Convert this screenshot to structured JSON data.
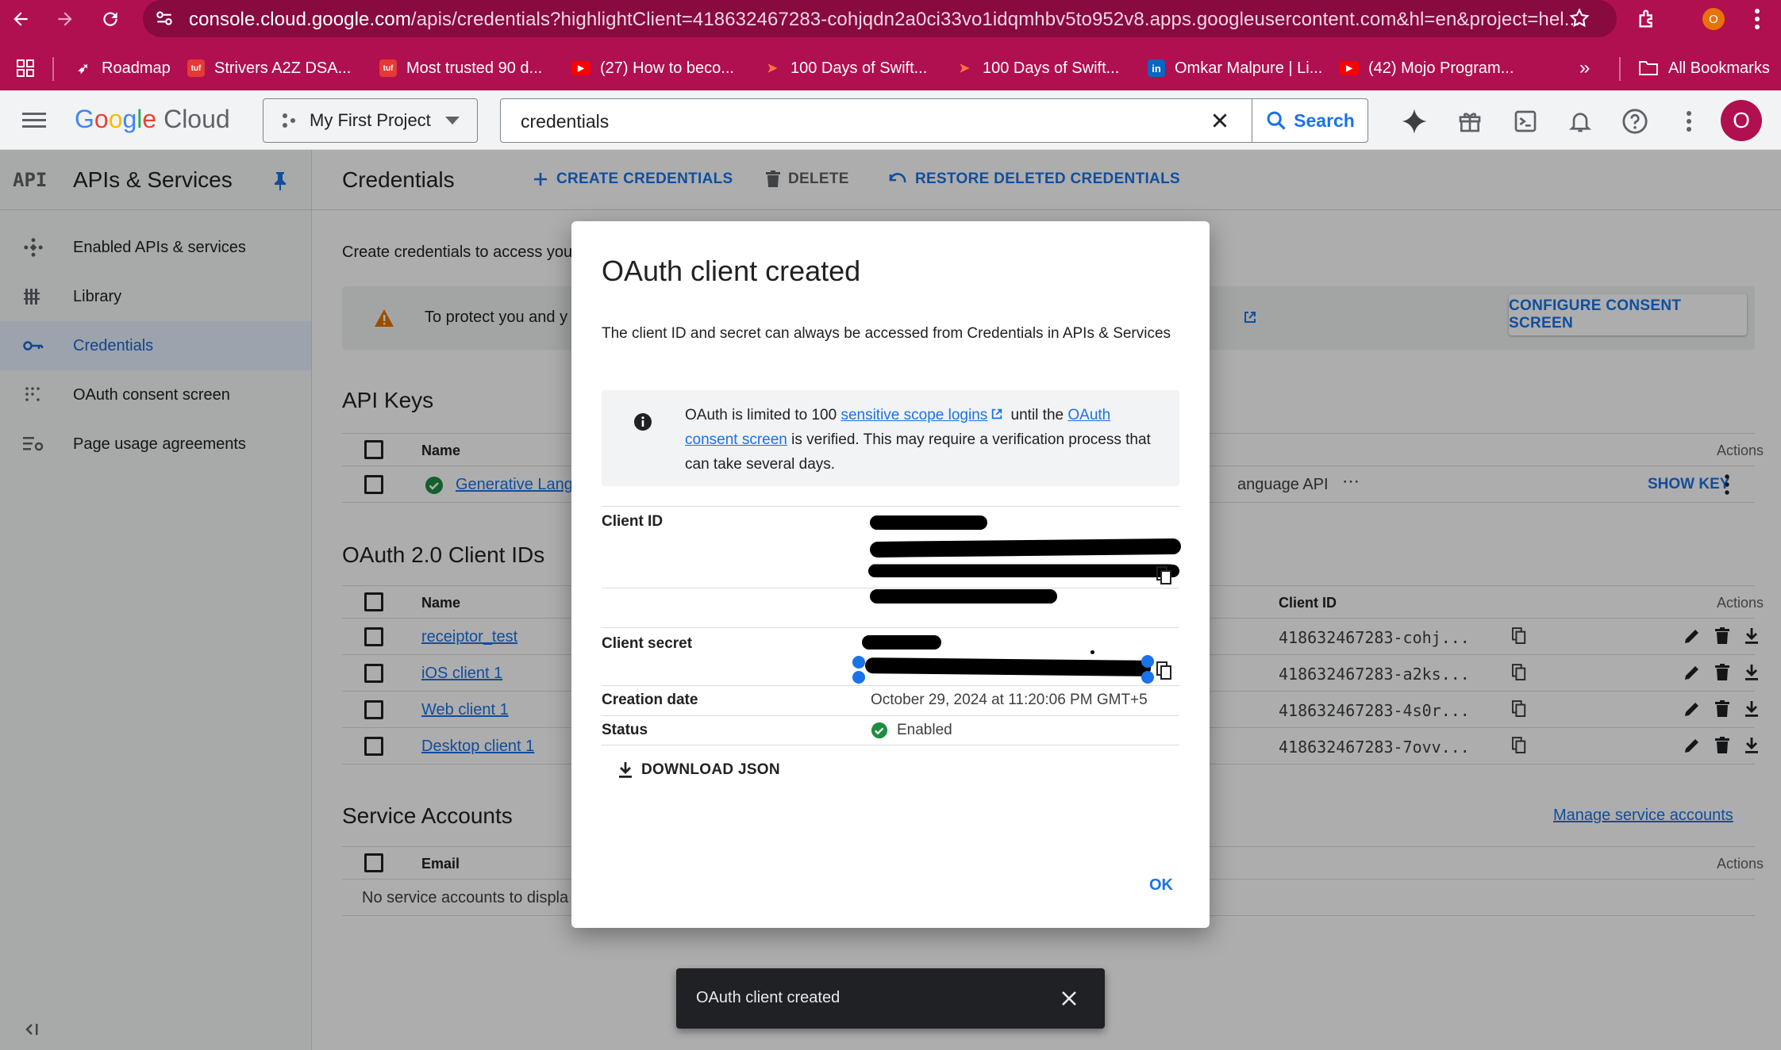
{
  "browser": {
    "url_domain": "console.cloud.google.com",
    "url_rest": "/apis/credentials?highlightClient=418632467283-cohjqdn2a0ci33vo1idqmhbv5to952v8.apps.googleusercontent.com&hl=en&project=hel...",
    "profile_initial": "O",
    "bookmarks": [
      {
        "label": "Roadmap",
        "icon": "rocket-icon"
      },
      {
        "label": "Strivers A2Z DSA...",
        "icon": "tuf-icon"
      },
      {
        "label": "Most trusted 90 d...",
        "icon": "tuf-icon"
      },
      {
        "label": "(27) How to beco...",
        "icon": "youtube-icon"
      },
      {
        "label": "100 Days of Swift...",
        "icon": "swift-icon"
      },
      {
        "label": "100 Days of Swift...",
        "icon": "swift-icon"
      },
      {
        "label": "Omkar Malpure | Li...",
        "icon": "linkedin-icon"
      },
      {
        "label": "(42) Mojo Program...",
        "icon": "youtube-icon"
      }
    ],
    "all_bookmarks_label": "All Bookmarks",
    "colors": {
      "chrome": "#b0104f",
      "address_bar": "#880a3f"
    }
  },
  "header": {
    "logo_google": "Google",
    "logo_cloud": " Cloud",
    "project": "My First Project",
    "search_value": "credentials",
    "search_label": "Search",
    "avatar_initial": "O"
  },
  "sidebar": {
    "badge": "API",
    "title": "APIs & Services",
    "items": [
      {
        "label": "Enabled APIs & services",
        "icon": "diamond-dots-icon"
      },
      {
        "label": "Library",
        "icon": "library-icon"
      },
      {
        "label": "Credentials",
        "icon": "key-icon"
      },
      {
        "label": "OAuth consent screen",
        "icon": "consent-dots-icon"
      },
      {
        "label": "Page usage agreements",
        "icon": "settings-list-icon"
      }
    ]
  },
  "main": {
    "title": "Credentials",
    "create_label": "CREATE CREDENTIALS",
    "delete_label": "DELETE",
    "restore_label": "RESTORE DELETED CREDENTIALS",
    "intro": "Create credentials to access you",
    "banner_text": "To protect you and y",
    "configure_label": "CONFIGURE CONSENT SCREEN",
    "api_keys": {
      "title": "API Keys",
      "col_name": "Name",
      "col_actions": "Actions",
      "rows": [
        {
          "name": "Generative Lang",
          "restriction": "anguage API",
          "action": "SHOW KEY"
        }
      ]
    },
    "oauth": {
      "title": "OAuth 2.0 Client IDs",
      "col_name": "Name",
      "col_client": "Client ID",
      "col_actions": "Actions",
      "rows": [
        {
          "name": "receiptor_test",
          "client_id": "418632467283-cohj..."
        },
        {
          "name": "iOS client 1",
          "client_id": "418632467283-a2ks..."
        },
        {
          "name": "Web client 1",
          "client_id": "418632467283-4s0r..."
        },
        {
          "name": "Desktop client 1",
          "client_id": "418632467283-7ovv..."
        }
      ]
    },
    "service_accounts": {
      "title": "Service Accounts",
      "manage_link": "Manage service accounts",
      "col_email": "Email",
      "col_actions": "Actions",
      "empty": "No service accounts to displa"
    }
  },
  "dialog": {
    "title": "OAuth client created",
    "description": "The client ID and secret can always be accessed from Credentials in APIs & Services",
    "note_pre": "OAuth is limited to 100 ",
    "note_link1": "sensitive scope logins",
    "note_mid": " until the ",
    "note_link2": "OAuth consent screen",
    "note_post": " is verified. This may require a verification process that can take several days.",
    "client_id_label": "Client ID",
    "client_secret_label": "Client secret",
    "creation_label": "Creation date",
    "creation_value": "October 29, 2024 at 11:20:06 PM GMT+5",
    "status_label": "Status",
    "status_value": "Enabled",
    "download_label": "DOWNLOAD JSON",
    "ok_label": "OK"
  },
  "snackbar": {
    "text": "OAuth client created"
  },
  "colors": {
    "accent": "#1a73e8",
    "success": "#1e8e3e",
    "warning": "#e37400"
  }
}
